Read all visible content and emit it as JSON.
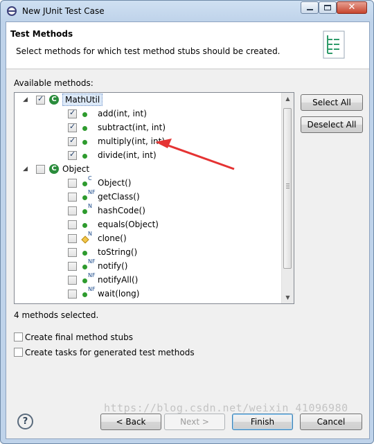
{
  "window": {
    "title": "New JUnit Test Case"
  },
  "header": {
    "title": "Test Methods",
    "description": "Select methods for which test method stubs should be created."
  },
  "available_label": "Available methods:",
  "tree": [
    {
      "label": "MathUtil",
      "level": 0,
      "checked": true,
      "icon": "class-icon",
      "expanded": true,
      "selected": true
    },
    {
      "label": "add(int, int)",
      "level": 1,
      "checked": true,
      "icon": "public-method-icon"
    },
    {
      "label": "subtract(int, int)",
      "level": 1,
      "checked": true,
      "icon": "public-method-icon"
    },
    {
      "label": "multiply(int, int)",
      "level": 1,
      "checked": true,
      "icon": "public-method-icon"
    },
    {
      "label": "divide(int, int)",
      "level": 1,
      "checked": true,
      "icon": "public-method-icon"
    },
    {
      "label": "Object",
      "level": 0,
      "checked": false,
      "icon": "class-icon",
      "expanded": true
    },
    {
      "label": "Object()",
      "level": 1,
      "checked": false,
      "icon": "public-method-icon",
      "modifier": "C"
    },
    {
      "label": "getClass()",
      "level": 1,
      "checked": false,
      "icon": "public-method-icon",
      "modifier": "NF"
    },
    {
      "label": "hashCode()",
      "level": 1,
      "checked": false,
      "icon": "public-method-icon",
      "modifier": "N"
    },
    {
      "label": "equals(Object)",
      "level": 1,
      "checked": false,
      "icon": "public-method-icon"
    },
    {
      "label": "clone()",
      "level": 1,
      "checked": false,
      "icon": "protected-method-icon",
      "modifier": "N"
    },
    {
      "label": "toString()",
      "level": 1,
      "checked": false,
      "icon": "public-method-icon"
    },
    {
      "label": "notify()",
      "level": 1,
      "checked": false,
      "icon": "public-method-icon",
      "modifier": "NF"
    },
    {
      "label": "notifyAll()",
      "level": 1,
      "checked": false,
      "icon": "public-method-icon",
      "modifier": "NF"
    },
    {
      "label": "wait(long)",
      "level": 1,
      "checked": false,
      "icon": "public-method-icon",
      "modifier": "NF"
    }
  ],
  "buttons": {
    "select_all": "Select All",
    "deselect_all": "Deselect All",
    "back": "< Back",
    "next": "Next >",
    "finish": "Finish",
    "cancel": "Cancel"
  },
  "status": "4 methods selected.",
  "options": [
    {
      "label": "Create final method stubs",
      "checked": false
    },
    {
      "label": "Create tasks for generated test methods",
      "checked": false
    }
  ],
  "help": "?",
  "watermark": "https://blog.csdn.net/weixin_41096980",
  "colors": {
    "annotation_arrow": "#e53333",
    "method_public": "#2e9b2e",
    "class_icon": "#2a8c3c"
  }
}
